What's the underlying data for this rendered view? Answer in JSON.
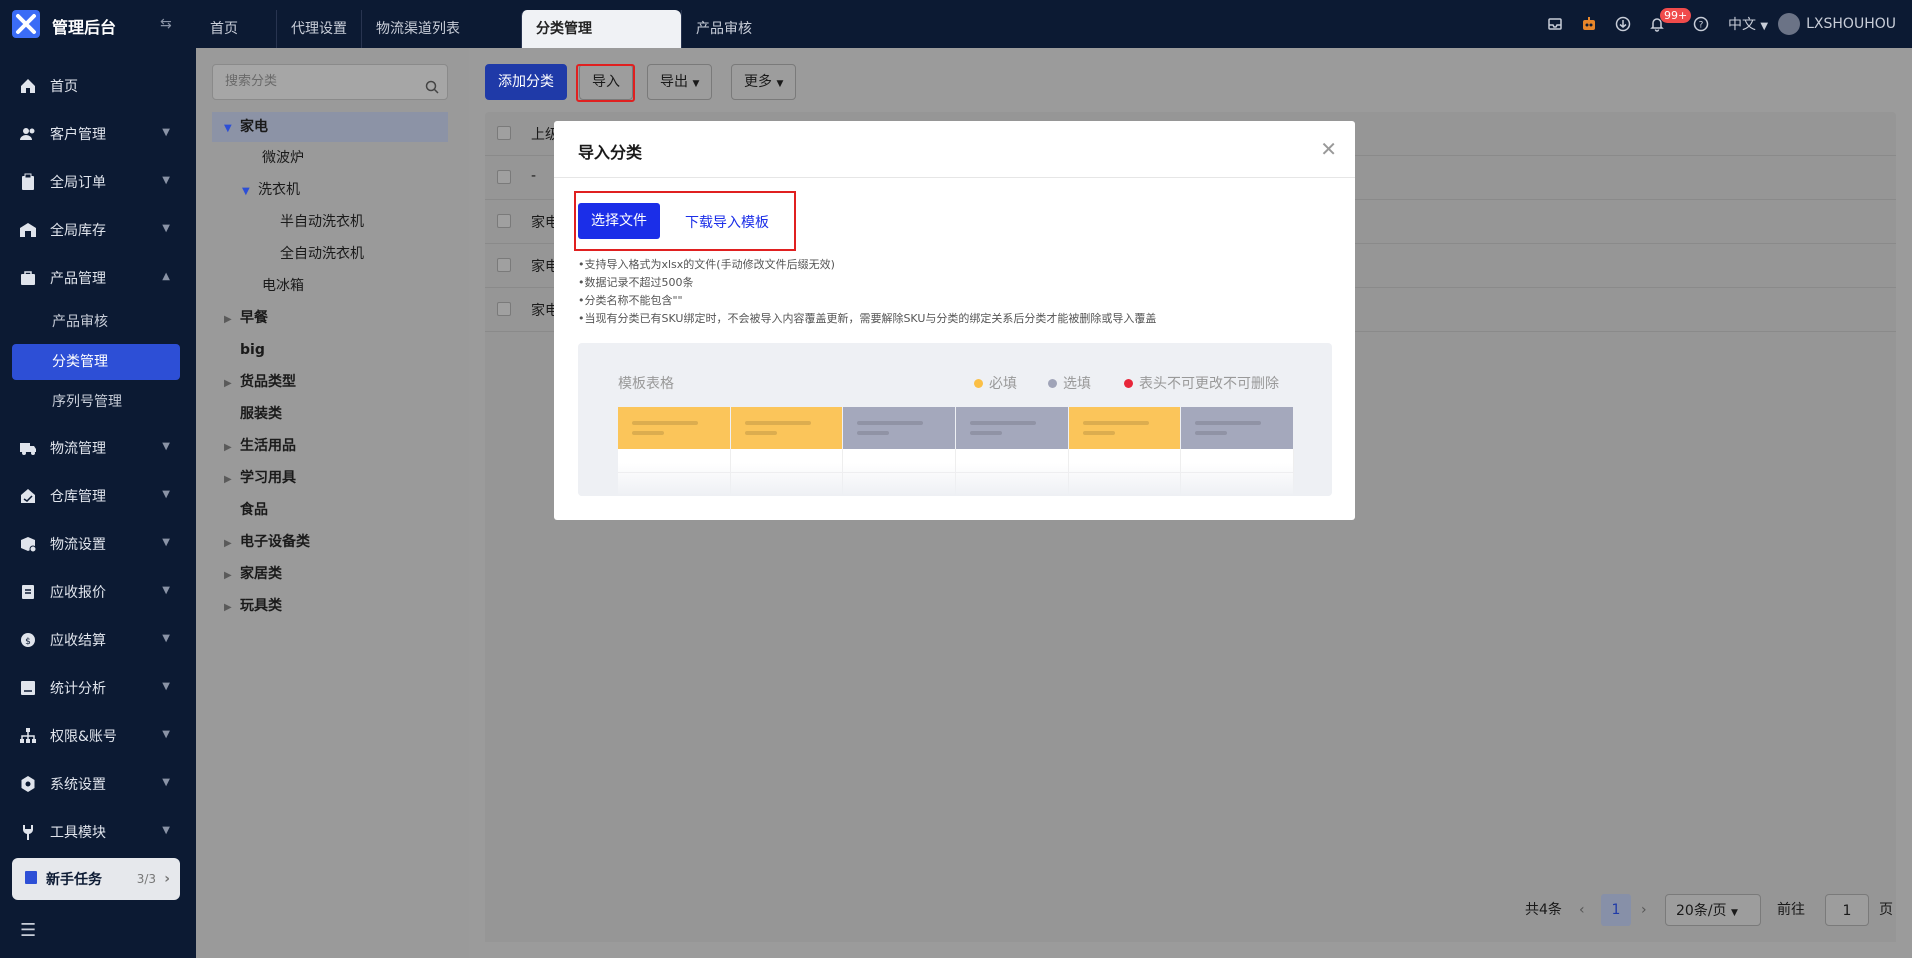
{
  "app": {
    "title": "管理后台"
  },
  "tabs": [
    {
      "label": "首页"
    },
    {
      "label": "代理设置"
    },
    {
      "label": "物流渠道列表"
    },
    {
      "label": "分类管理"
    },
    {
      "label": "产品审核"
    }
  ],
  "header": {
    "notif_badge": "99+",
    "language": "中文",
    "username": "LXSHOUHOU"
  },
  "sidebar": {
    "items": [
      {
        "label": "首页",
        "icon": "home-icon"
      },
      {
        "label": "客户管理",
        "icon": "users-icon"
      },
      {
        "label": "全局订单",
        "icon": "clipboard-icon"
      },
      {
        "label": "全局库存",
        "icon": "warehouse-icon"
      },
      {
        "label": "产品管理",
        "icon": "bag-icon"
      },
      {
        "label": "物流管理",
        "icon": "truck-icon"
      },
      {
        "label": "仓库管理",
        "icon": "store-icon"
      },
      {
        "label": "物流设置",
        "icon": "box-icon"
      },
      {
        "label": "应收报价",
        "icon": "document-icon"
      },
      {
        "label": "应收结算",
        "icon": "coin-icon"
      },
      {
        "label": "统计分析",
        "icon": "chart-icon"
      },
      {
        "label": "权限&账号",
        "icon": "org-icon"
      },
      {
        "label": "系统设置",
        "icon": "gear-icon"
      },
      {
        "label": "工具模块",
        "icon": "wrench-icon"
      }
    ],
    "sub_items": [
      {
        "label": "产品审核"
      },
      {
        "label": "分类管理"
      },
      {
        "label": "序列号管理"
      }
    ],
    "task": {
      "label": "新手任务",
      "count": "3/3"
    }
  },
  "tree": {
    "search_placeholder": "搜索分类",
    "nodes": [
      {
        "label": "家电"
      },
      {
        "label": "微波炉"
      },
      {
        "label": "洗衣机"
      },
      {
        "label": "半自动洗衣机"
      },
      {
        "label": "全自动洗衣机"
      },
      {
        "label": "电冰箱"
      },
      {
        "label": "早餐"
      },
      {
        "label": "big"
      },
      {
        "label": "货品类型"
      },
      {
        "label": "服装类"
      },
      {
        "label": "生活用品"
      },
      {
        "label": "学习用具"
      },
      {
        "label": "食品"
      },
      {
        "label": "电子设备类"
      },
      {
        "label": "家居类"
      },
      {
        "label": "玩具类"
      }
    ]
  },
  "toolbar": {
    "add": "添加分类",
    "import": "导入",
    "export": "导出",
    "more": "更多"
  },
  "table": {
    "rows": [
      {
        "text": "上级"
      },
      {
        "text": "-"
      },
      {
        "text": "家电"
      },
      {
        "text": "家电"
      },
      {
        "text": "家电"
      }
    ]
  },
  "pagination": {
    "total": "共4条",
    "page": "1",
    "size": "20条/页",
    "goto_prefix": "前往",
    "goto_value": "1",
    "goto_suffix": "页"
  },
  "modal": {
    "title": "导入分类",
    "choose_file": "选择文件",
    "download_template": "下载导入模板",
    "notes": [
      "•支持导入格式为xlsx的文件(手动修改文件后缀无效)",
      "•数据记录不超过500条",
      "•分类名称不能包含\"\"",
      "•当现有分类已有SKU绑定时，不会被导入内容覆盖更新，需要解除SKU与分类的绑定关系后分类才能被删除或导入覆盖"
    ],
    "template": {
      "title": "模板表格",
      "legend": [
        {
          "label": "必填",
          "color": "#fbbf45"
        },
        {
          "label": "选填",
          "color": "#a0a4b8"
        },
        {
          "label": "表头不可更改不可删除",
          "color": "#e8263a"
        }
      ],
      "column_colors": [
        "#fbc55a",
        "#fbc55a",
        "#a4a8bc",
        "#a4a8bc",
        "#fbc55a",
        "#a4a8bc"
      ]
    }
  }
}
